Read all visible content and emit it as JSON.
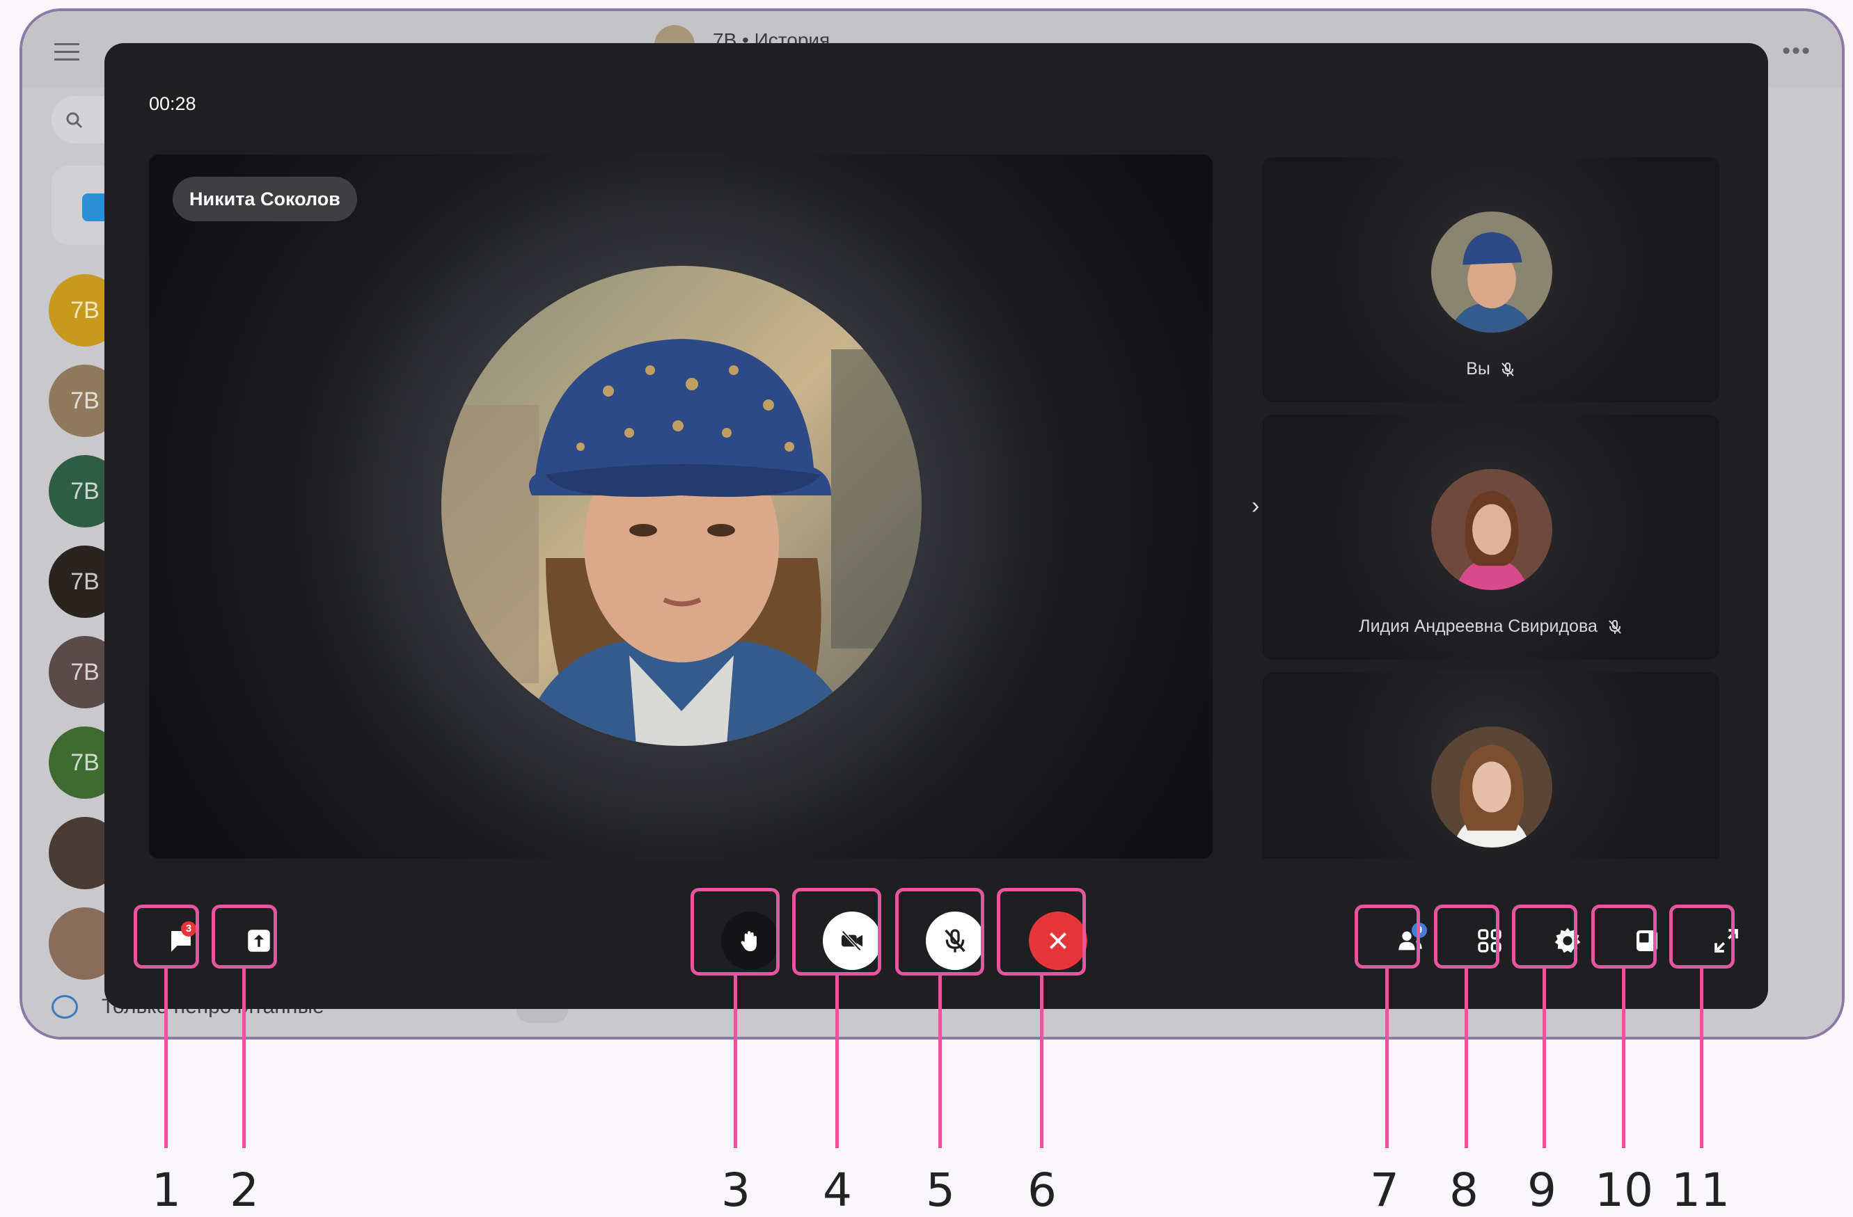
{
  "background_app": {
    "chat_title": "7В • История",
    "chat_avatars": [
      "7В",
      "7В",
      "7В",
      "7В",
      "7В",
      "7В",
      "",
      ""
    ],
    "footer_filter_label": "Только непрочитанные"
  },
  "call": {
    "timer": "00:28",
    "main_speaker": {
      "name": "Никита Соколов"
    },
    "participants": [
      {
        "label": "Вы",
        "mic_muted": true
      },
      {
        "label": "Лидия Андреевна Свиридова",
        "mic_muted": true
      },
      {
        "label": "",
        "mic_muted": false
      }
    ],
    "chat_badge": "3",
    "participants_badge": "9"
  },
  "icons": {
    "chat": "chat-bubble-icon",
    "share": "upload-share-icon",
    "hand": "raise-hand-icon",
    "camera": "camera-off-icon",
    "mic": "mic-off-icon",
    "end": "end-call-icon",
    "participants": "participants-icon",
    "grid": "grid-layout-icon",
    "settings": "gear-icon",
    "pip": "picture-in-picture-icon",
    "fullscreen": "fullscreen-icon"
  },
  "colors": {
    "annotation": "#e4569f",
    "end_call": "#e4353b",
    "badge_chat": "#e4353b",
    "badge_participants": "#4a7bd8"
  },
  "callouts": [
    "1",
    "2",
    "3",
    "4",
    "5",
    "6",
    "7",
    "8",
    "9",
    "10",
    "11"
  ]
}
